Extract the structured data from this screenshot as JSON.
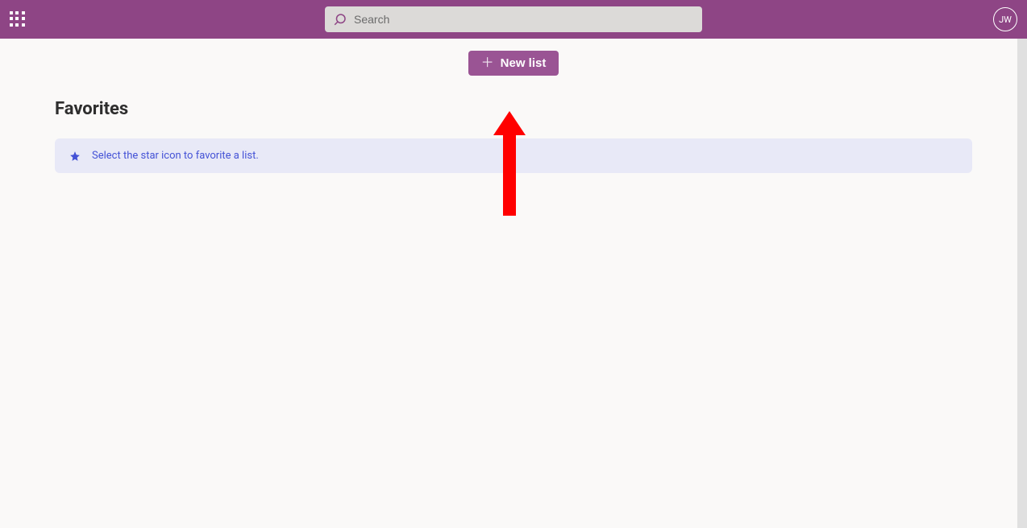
{
  "header": {
    "search_placeholder": "Search",
    "avatar_initials": "JW"
  },
  "actions": {
    "new_list_label": "New list"
  },
  "page": {
    "title": "Favorites",
    "empty_hint": "Select the star icon to favorite a list."
  }
}
